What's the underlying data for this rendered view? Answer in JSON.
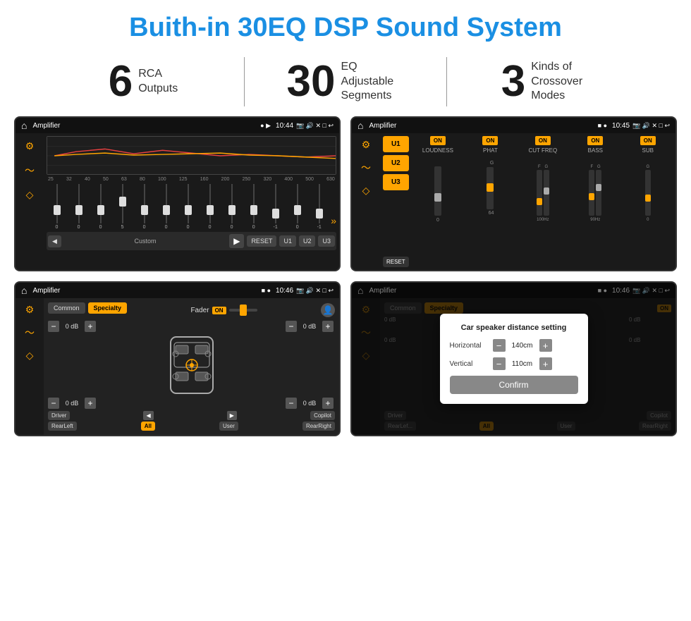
{
  "page": {
    "title": "Buith-in 30EQ DSP Sound System"
  },
  "stats": [
    {
      "number": "6",
      "label": "RCA\nOutputs"
    },
    {
      "number": "30",
      "label": "EQ Adjustable\nSegments"
    },
    {
      "number": "3",
      "label": "Kinds of\nCrossover Modes"
    }
  ],
  "screens": {
    "eq": {
      "title": "Amplifier",
      "time": "10:44",
      "freqs": [
        "25",
        "32",
        "40",
        "50",
        "63",
        "80",
        "100",
        "125",
        "160",
        "200",
        "250",
        "320",
        "400",
        "500",
        "630"
      ],
      "values": [
        "0",
        "0",
        "0",
        "5",
        "0",
        "0",
        "0",
        "0",
        "0",
        "0",
        "-1",
        "0",
        "-1"
      ],
      "mode_label": "Custom",
      "buttons": [
        "RESET",
        "U1",
        "U2",
        "U3"
      ]
    },
    "crossover": {
      "title": "Amplifier",
      "time": "10:45",
      "u_buttons": [
        "U1",
        "U2",
        "U3"
      ],
      "channels": [
        "LOUDNESS",
        "PHAT",
        "CUT FREQ",
        "BASS",
        "SUB"
      ],
      "reset": "RESET"
    },
    "fader": {
      "title": "Amplifier",
      "time": "10:46",
      "tabs": [
        "Common",
        "Specialty"
      ],
      "fader_label": "Fader",
      "on": "ON",
      "vol_left1": "0 dB",
      "vol_right1": "0 dB",
      "vol_left2": "0 dB",
      "vol_right2": "0 dB",
      "driver": "Driver",
      "copilot": "Copilot",
      "rearleft": "RearLeft",
      "all": "All",
      "user": "User",
      "rearright": "RearRight"
    },
    "dialog": {
      "title": "Amplifier",
      "time": "10:46",
      "dialog_title": "Car speaker distance setting",
      "horizontal_label": "Horizontal",
      "horizontal_value": "140cm",
      "vertical_label": "Vertical",
      "vertical_value": "110cm",
      "confirm": "Confirm",
      "driver": "Driver",
      "copilot": "Copilot",
      "rearleft": "RearLef...",
      "all": "All",
      "user": "User",
      "rearright": "RearRight",
      "vol_right1": "0 dB",
      "vol_right2": "0 dB"
    }
  }
}
